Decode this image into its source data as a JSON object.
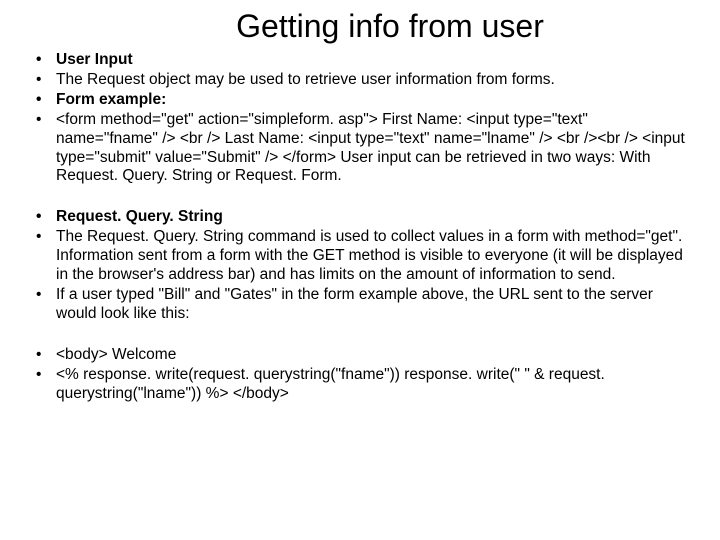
{
  "title": "Getting info from user",
  "group1": {
    "b0": "User Input",
    "b1": "The Request object may be used to retrieve user information from forms.",
    "b2": "Form example:",
    "b3": "<form method=\"get\" action=\"simpleform. asp\"> First Name: <input type=\"text\" name=\"fname\" /> <br /> Last Name: <input type=\"text\" name=\"lname\" /> <br /><br /> <input type=\"submit\" value=\"Submit\" /> </form> User input can be retrieved in two ways: With Request. Query. String or Request. Form."
  },
  "group2": {
    "b0": "Request. Query. String",
    "b1": "The Request. Query. String command is used to collect values in a form with method=\"get\". Information sent from a form with the GET method is visible to everyone (it will be displayed in the browser's address bar) and has limits on the amount of information to send.",
    "b2": "If a user typed \"Bill\" and \"Gates\" in the form example above, the URL sent to the server would look like this:"
  },
  "group3": {
    "b0": "<body> Welcome",
    "b1": "<% response. write(request. querystring(\"fname\")) response. write(\" \" & request. querystring(\"lname\")) %> </body>"
  }
}
